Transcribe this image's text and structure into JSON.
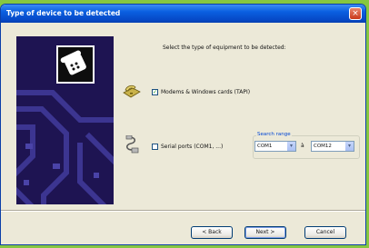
{
  "window": {
    "title": "Type of device to be detected",
    "close_glyph": "×"
  },
  "intro": "Select the type of equipment to be detected:",
  "options": [
    {
      "icon": "modem-icon",
      "checked": true,
      "check_glyph": "✓",
      "label": "Modems & Windows cards (TAPI)"
    },
    {
      "icon": "serial-cable-icon",
      "checked": false,
      "check_glyph": "",
      "label": "Serial ports (COM1, ...)"
    }
  ],
  "search_range": {
    "legend": "Search range",
    "from": "COM1",
    "separator": "à",
    "to": "COM12"
  },
  "buttons": {
    "back": "< Back",
    "next": "Next >",
    "cancel": "Cancel"
  },
  "colors": {
    "desktop": "#86c740",
    "titlebar": "#0a5fe0",
    "dialog": "#ece9d8",
    "side_panel": "#1e1452"
  }
}
